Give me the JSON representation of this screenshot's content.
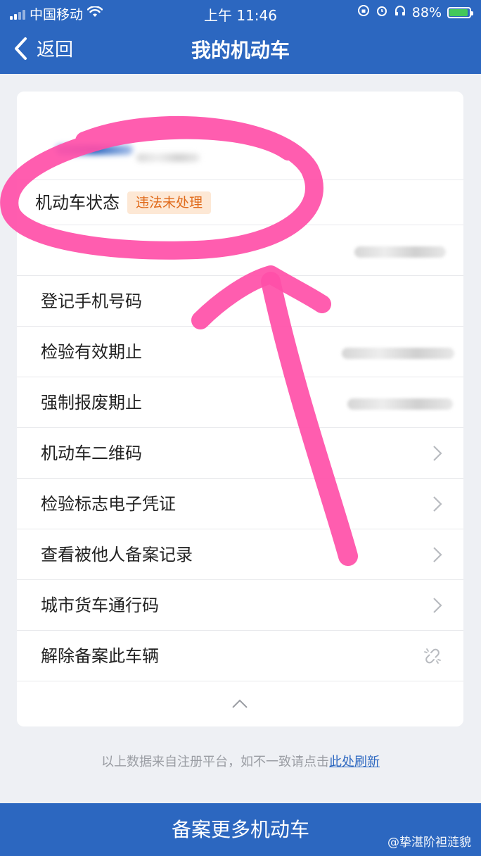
{
  "status_bar": {
    "carrier": "中国移动",
    "time": "上午 11:46",
    "battery": "88%"
  },
  "nav": {
    "back_label": "返回",
    "title": "我的机动车"
  },
  "vehicle_status": {
    "label": "机动车状态",
    "badge": "违法未处理"
  },
  "rows": [
    {
      "label": "登记手机号码"
    },
    {
      "label": "检验有效期止"
    },
    {
      "label": "强制报废期止"
    },
    {
      "label": "机动车二维码"
    },
    {
      "label": "检验标志电子凭证"
    },
    {
      "label": "查看被他人备案记录"
    },
    {
      "label": "城市货车通行码"
    },
    {
      "label": "解除备案此车辆"
    }
  ],
  "footnote": {
    "text": "以上数据来自注册平台，如不一致请点击",
    "link": "此处刷新"
  },
  "bottom_button": "备案更多机动车",
  "watermark": "@挚湛阶袒涟貌",
  "colors": {
    "primary": "#2c67c0",
    "badge_text": "#e06a1a",
    "badge_bg": "#fde8d5",
    "marker": "#ff4fa8"
  }
}
